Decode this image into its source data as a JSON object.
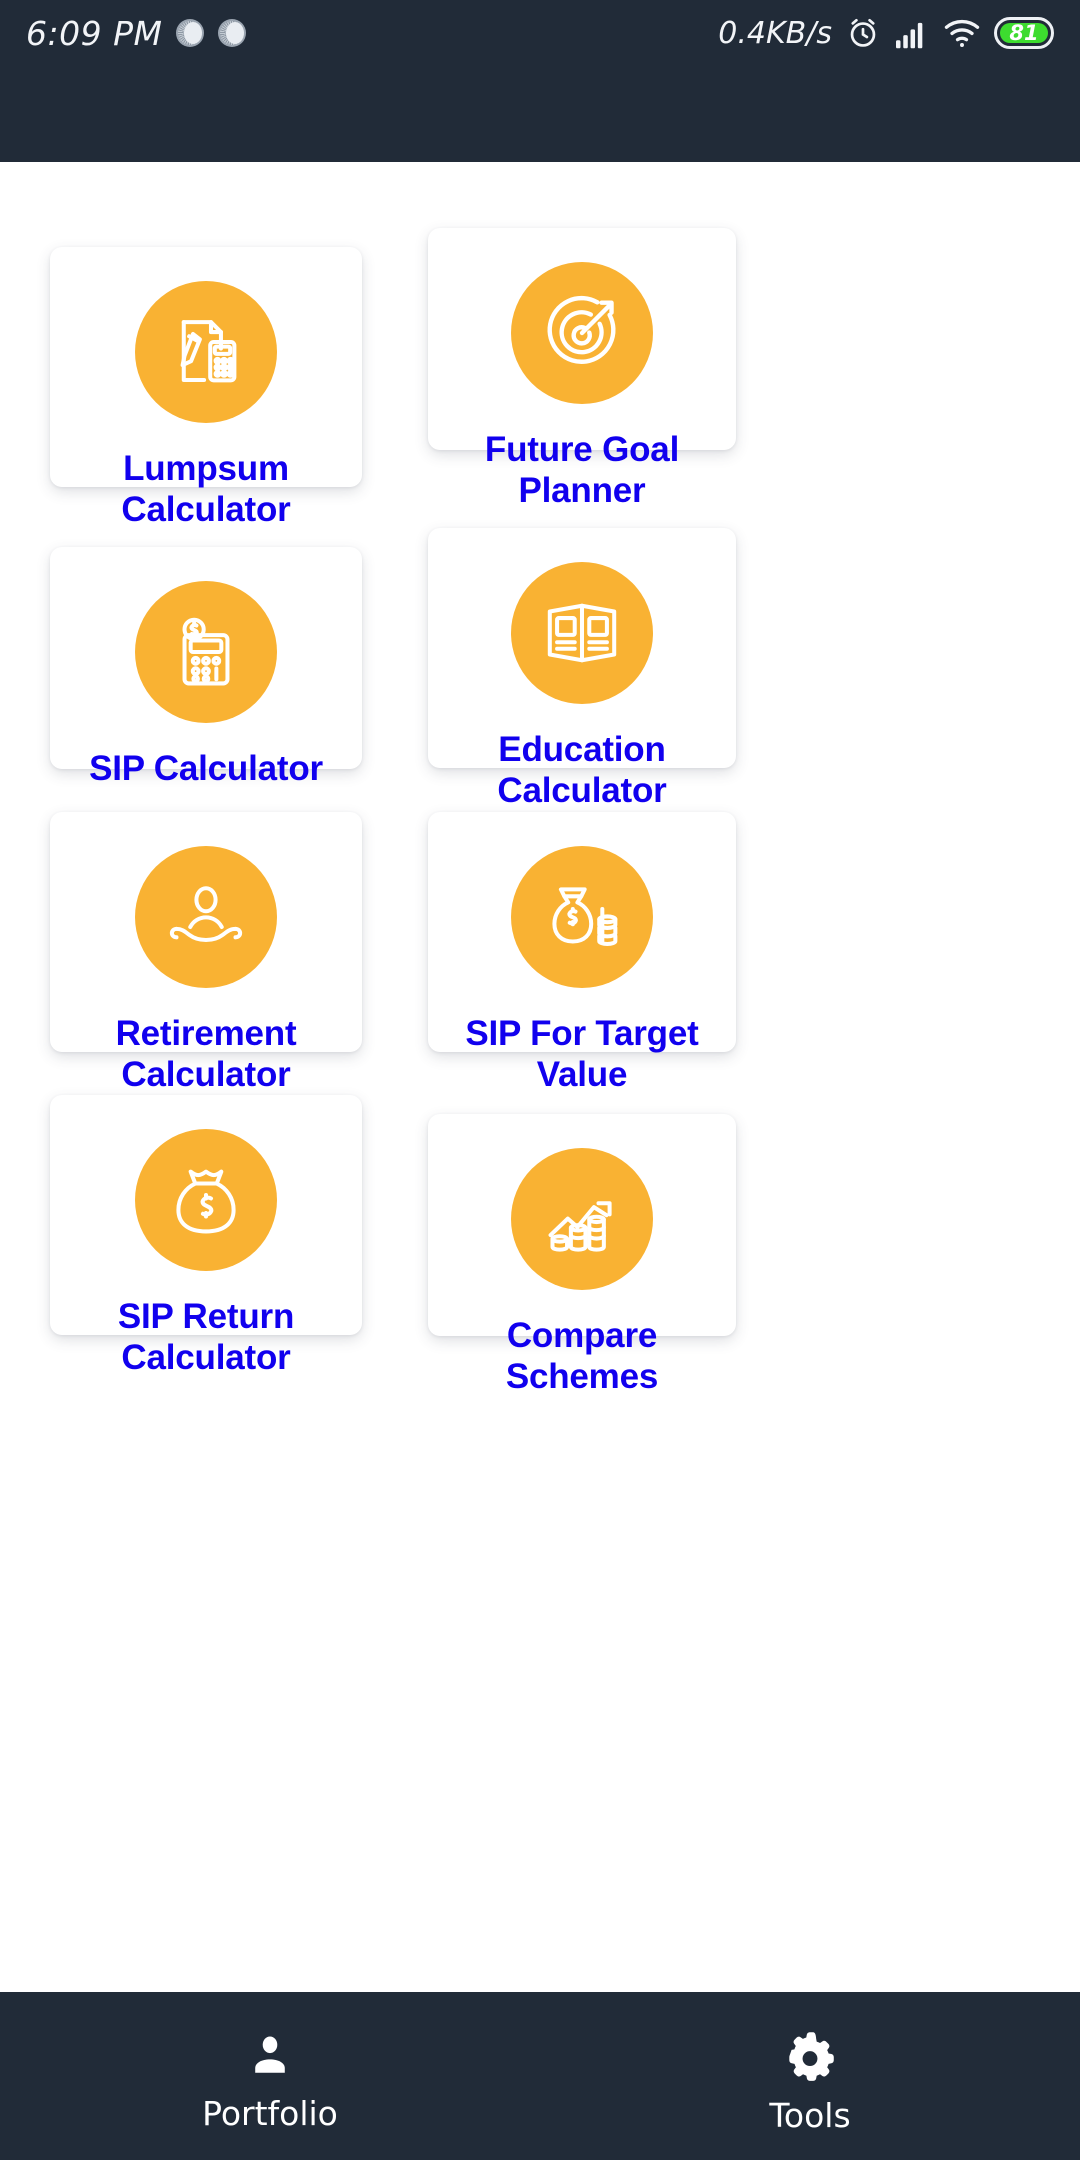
{
  "status_bar": {
    "time": "6:09 PM",
    "network_speed": "0.4KB/s",
    "battery_level": "81",
    "icons": [
      "sync-circle-icon",
      "sync-circle-icon",
      "alarm-clock-icon",
      "cellular-signal-icon",
      "wifi-icon",
      "battery-icon"
    ],
    "background_color": "#212b38"
  },
  "theme": {
    "accent_orange": "#f9b233",
    "label_blue": "#1100ee",
    "dark_navy": "#212b38",
    "card_white": "#ffffff"
  },
  "main": {
    "tools": [
      {
        "label": "Lumpsum\nCalculator",
        "line1": "Lumpsum",
        "line2": "Calculator",
        "icon": "document-pencil-calculator-icon"
      },
      {
        "label": "Future Goal Planner",
        "line1": "Future Goal Planner",
        "line2": "",
        "icon": "target-dartboard-icon"
      },
      {
        "label": "SIP Calculator",
        "line1": "SIP Calculator",
        "line2": "",
        "icon": "calculator-coin-icon"
      },
      {
        "label": "Education\nCalculator",
        "line1": "Education",
        "line2": "Calculator",
        "icon": "open-book-icon"
      },
      {
        "label": "Retirement\nCalculator",
        "line1": "Retirement",
        "line2": "Calculator",
        "icon": "person-in-hand-icon"
      },
      {
        "label": "SIP For Target\nValue",
        "line1": "SIP For Target",
        "line2": "Value",
        "icon": "money-bag-coins-icon"
      },
      {
        "label": "SIP Return\nCalculator",
        "line1": "SIP Return",
        "line2": "Calculator",
        "icon": "money-bag-icon"
      },
      {
        "label": "Compare Schemes",
        "line1": "Compare Schemes",
        "line2": "",
        "icon": "growth-chart-coins-icon"
      }
    ]
  },
  "bottom_nav": {
    "items": [
      {
        "label": "Portfolio",
        "icon": "person-icon"
      },
      {
        "label": "Tools",
        "icon": "gear-icon"
      }
    ]
  }
}
